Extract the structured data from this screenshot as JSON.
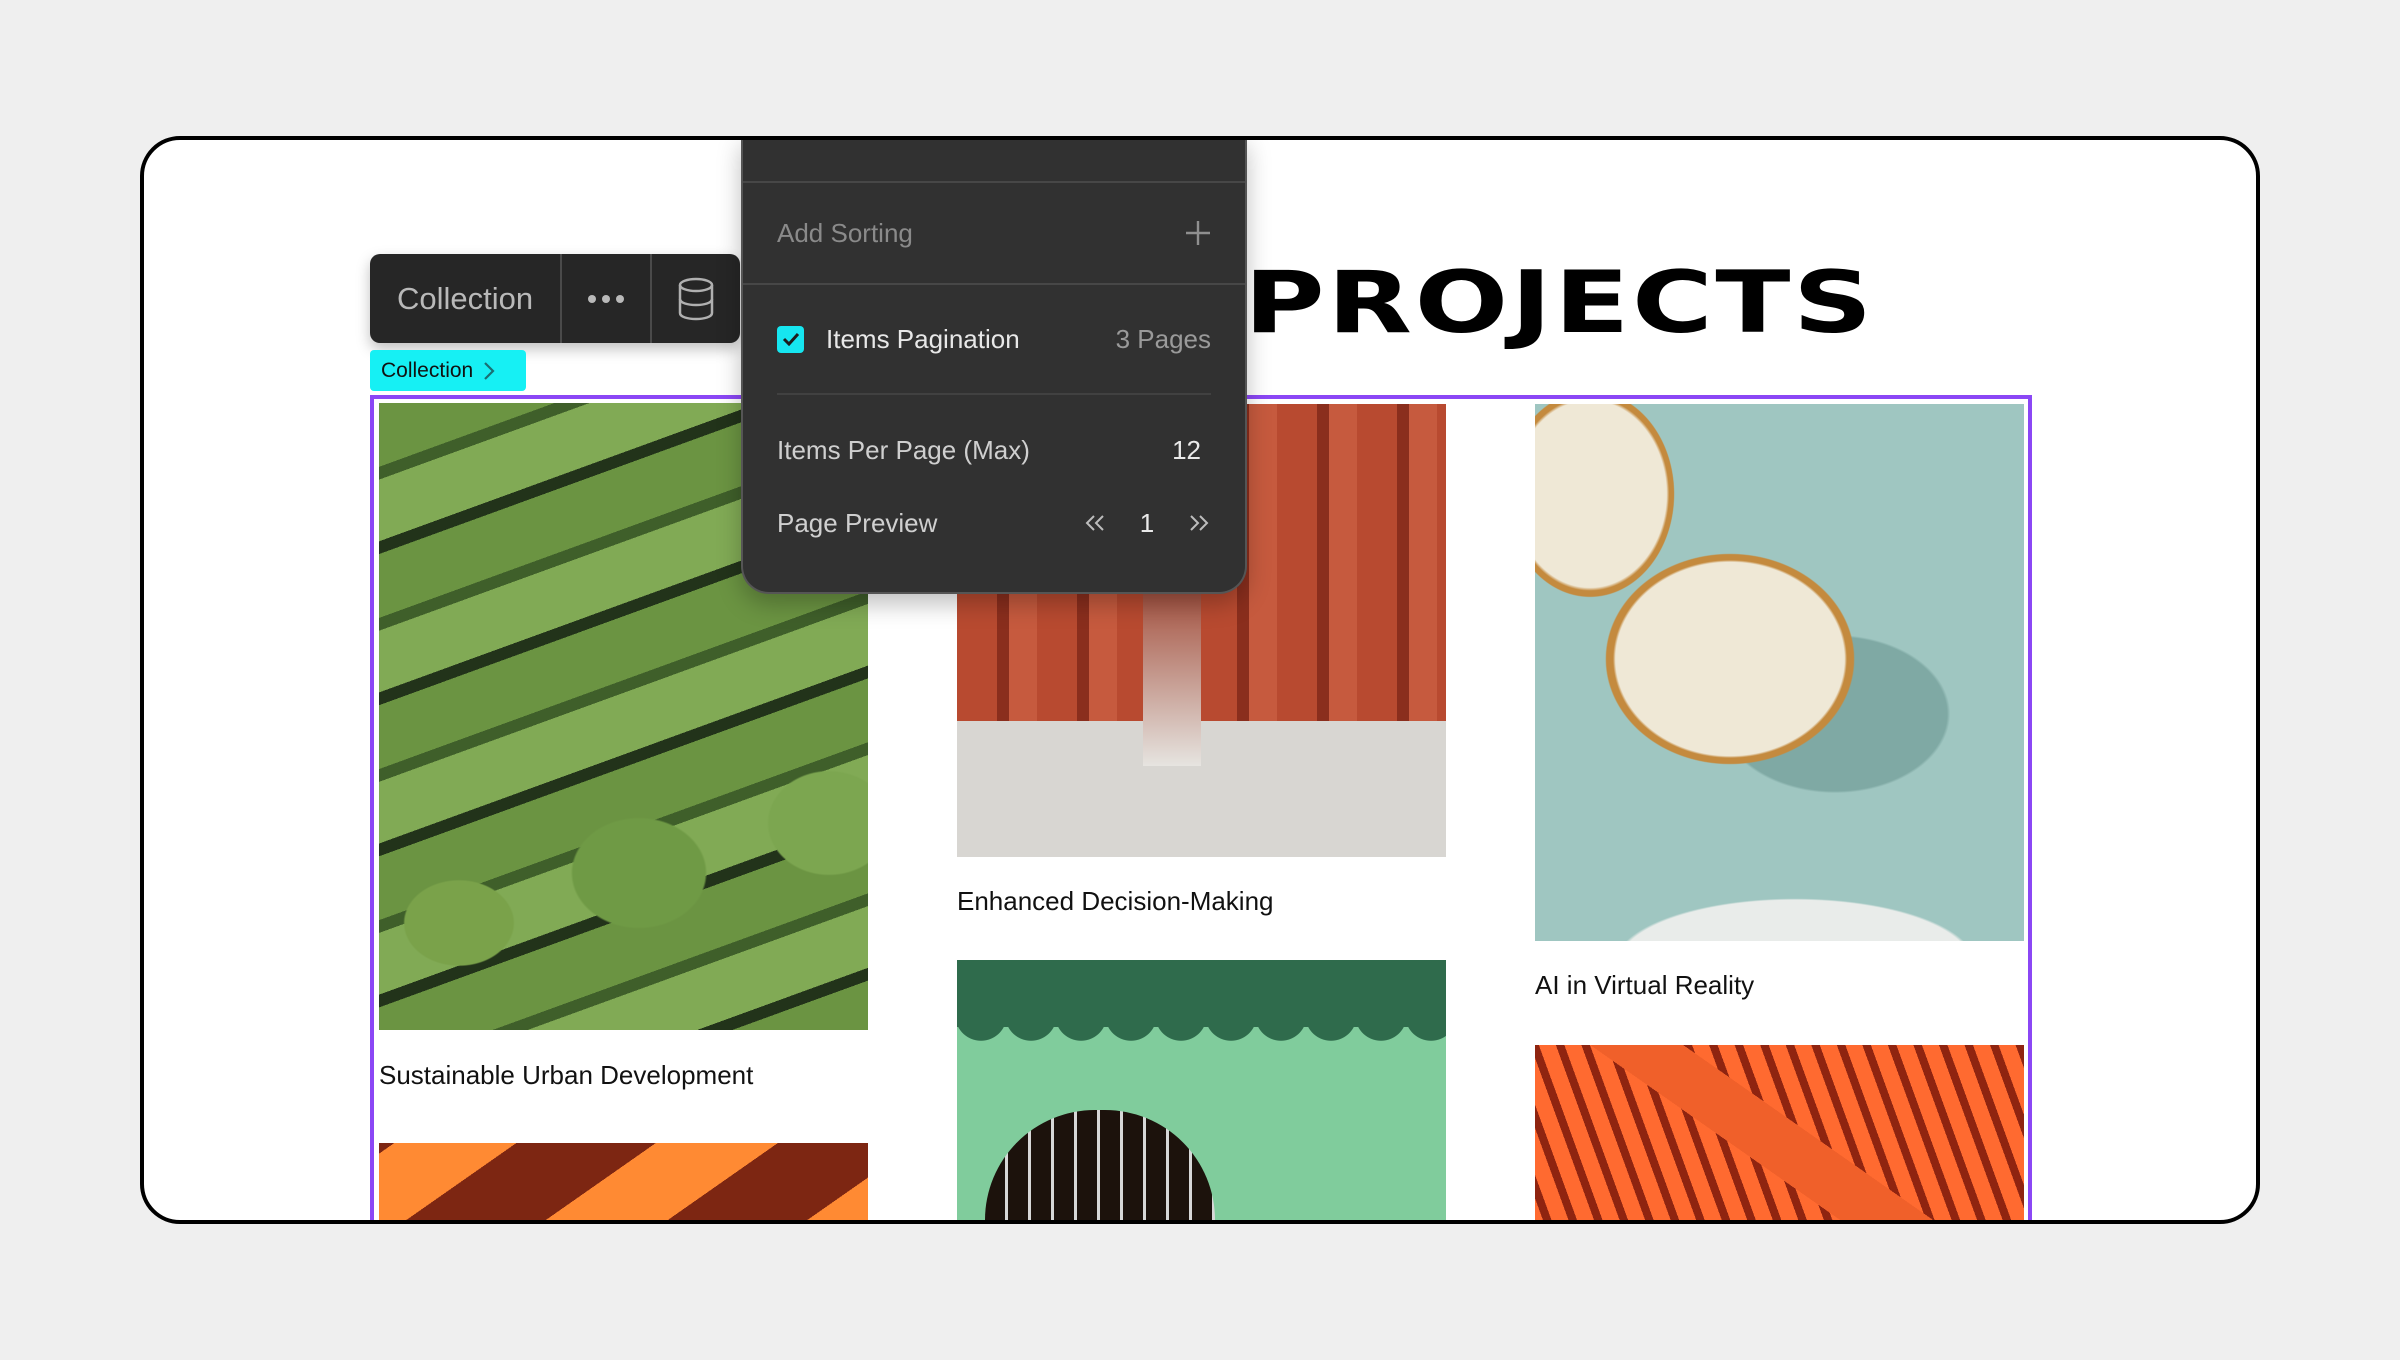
{
  "page": {
    "heading": "PROJECTS"
  },
  "toolbar": {
    "title": "Collection",
    "more_icon": "more-horizontal-icon",
    "database_icon": "database-icon"
  },
  "breadcrumb_badge": {
    "label": "Collection",
    "icon": "chevron-right-icon",
    "color": "#16f0f4"
  },
  "selection_color": "#8b47f5",
  "popup": {
    "add_sorting_label": "Add Sorting",
    "add_icon": "plus-icon",
    "pagination": {
      "label": "Items Pagination",
      "checked": true,
      "pages_value": "3 Pages"
    },
    "items_per_page": {
      "label": "Items Per Page (Max)",
      "value": "12"
    },
    "page_preview": {
      "label": "Page Preview",
      "prev_icon": "chevrons-left-icon",
      "current": "1",
      "next_icon": "chevrons-right-icon"
    }
  },
  "cards": [
    {
      "title": "Sustainable Urban Development",
      "image": "green stadium seats"
    },
    {
      "title": "Enhanced Decision-Making",
      "image": "red colonnade corridor"
    },
    {
      "title": "AI in Virtual Reality",
      "image": "leaf-print chair on teal"
    },
    {
      "title": "",
      "image": "orange diagonal shadows"
    },
    {
      "title": "",
      "image": "green wall with barred window"
    },
    {
      "title": "",
      "image": "orange corrugated roof"
    }
  ]
}
